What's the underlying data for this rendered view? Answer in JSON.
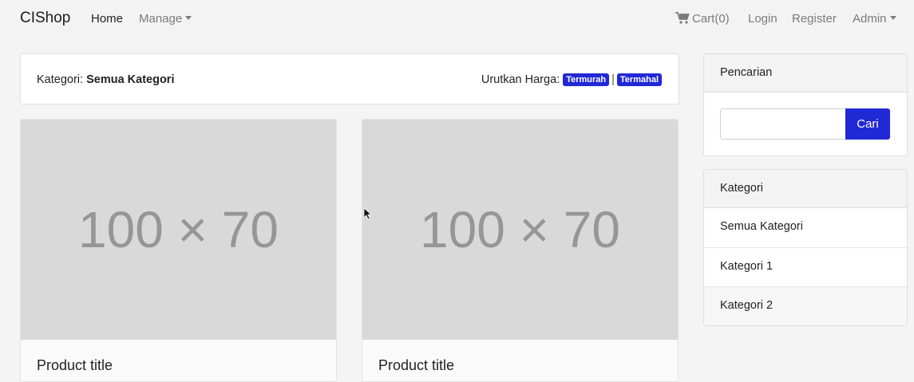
{
  "navbar": {
    "brand": "CIShop",
    "home": "Home",
    "manage": "Manage",
    "cart": "Cart(0)",
    "login": "Login",
    "register": "Register",
    "admin": "Admin"
  },
  "category_bar": {
    "label": "Kategori:",
    "current": "Semua Kategori",
    "sort_label": "Urutkan Harga:",
    "sort_cheapest": "Termurah",
    "sort_separator": "|",
    "sort_expensive": "Termahal"
  },
  "products": [
    {
      "image_text": "100 × 70",
      "title": "Product title"
    },
    {
      "image_text": "100 × 70",
      "title": "Product title"
    }
  ],
  "sidebar": {
    "search": {
      "title": "Pencarian",
      "value": "",
      "button": "Cari"
    },
    "categories": {
      "title": "Kategori",
      "items": [
        "Semua Kategori",
        "Kategori 1",
        "Kategori 2"
      ]
    }
  },
  "colors": {
    "accent": "#2128d6",
    "placeholder_bg": "#d9d9d9",
    "placeholder_text": "#969696"
  }
}
